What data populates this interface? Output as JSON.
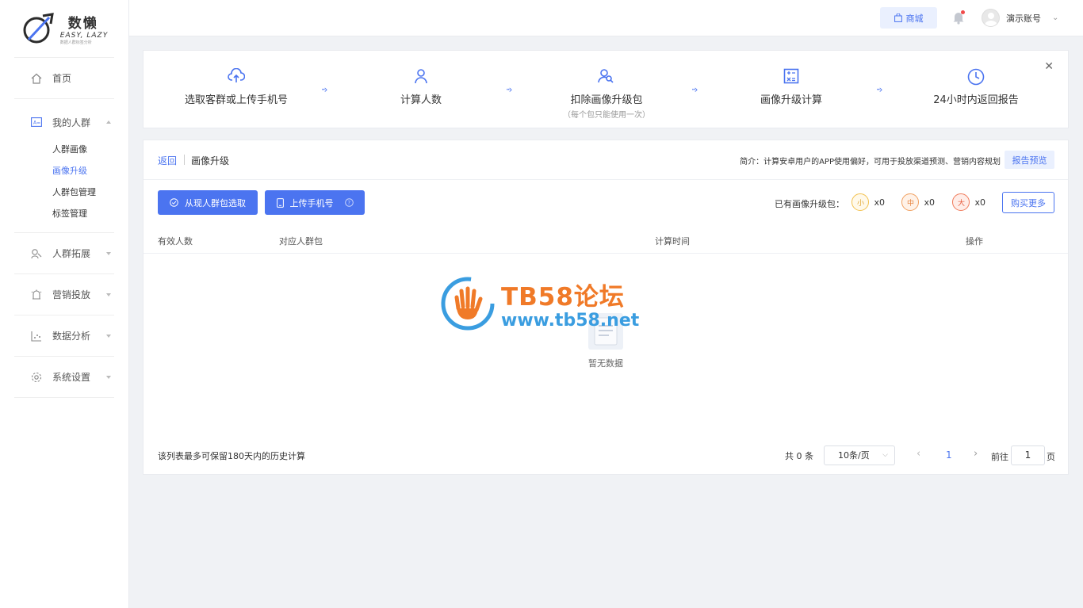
{
  "brand": {
    "name_cn": "数懒",
    "name_en": "EASY, LAZY",
    "tagline": "数据人群标签分析"
  },
  "sidebar": {
    "items": [
      {
        "label": "首页",
        "icon": "home-icon"
      },
      {
        "label": "我的人群",
        "icon": "crowd-icon",
        "expanded": true,
        "children": [
          "人群画像",
          "画像升级",
          "人群包管理",
          "标签管理"
        ],
        "active_child": "画像升级"
      },
      {
        "label": "人群拓展",
        "icon": "expand-icon"
      },
      {
        "label": "营销投放",
        "icon": "marketing-icon"
      },
      {
        "label": "数据分析",
        "icon": "analysis-icon"
      },
      {
        "label": "系统设置",
        "icon": "settings-icon"
      }
    ]
  },
  "header": {
    "shop_label": "商城",
    "user_name": "演示账号"
  },
  "steps": [
    {
      "title": "选取客群或上传手机号",
      "sub": "",
      "icon": "upload-cloud-icon"
    },
    {
      "title": "计算人数",
      "sub": "",
      "icon": "user-icon"
    },
    {
      "title": "扣除画像升级包",
      "sub": "（每个包只能使用一次）",
      "icon": "user-search-icon"
    },
    {
      "title": "画像升级计算",
      "sub": "",
      "icon": "calculator-icon"
    },
    {
      "title": "24小时内返回报告",
      "sub": "",
      "icon": "clock-icon"
    }
  ],
  "main": {
    "back_label": "返回",
    "crumb": "画像升级",
    "intro": "简介：计算安卓用户的APP使用偏好，可用于投放渠道预测、营销内容规划",
    "preview_label": "报告预览",
    "btn_select": "从现人群包选取",
    "btn_upload": "上传手机号",
    "pkg_label": "已有画像升级包：",
    "packages": [
      {
        "size": "小",
        "count": "x0",
        "color": "#f2c14e"
      },
      {
        "size": "中",
        "count": "x0",
        "color": "#f0a060"
      },
      {
        "size": "大",
        "count": "x0",
        "color": "#f07a5a"
      }
    ],
    "buy_label": "购买更多",
    "columns": [
      "有效人数",
      "对应人群包",
      "计算时间",
      "操作"
    ],
    "empty_text": "暂无数据",
    "footer_note": "该列表最多可保留180天内的历史计算",
    "total": "共 0 条",
    "page_size": "10条/页",
    "current_page": "1",
    "goto_label": "前往",
    "goto_value": "1",
    "page_unit": "页"
  },
  "watermark": {
    "title": "TB58论坛",
    "url": "www.tb58.net"
  },
  "colors": {
    "accent": "#4b74f0"
  }
}
